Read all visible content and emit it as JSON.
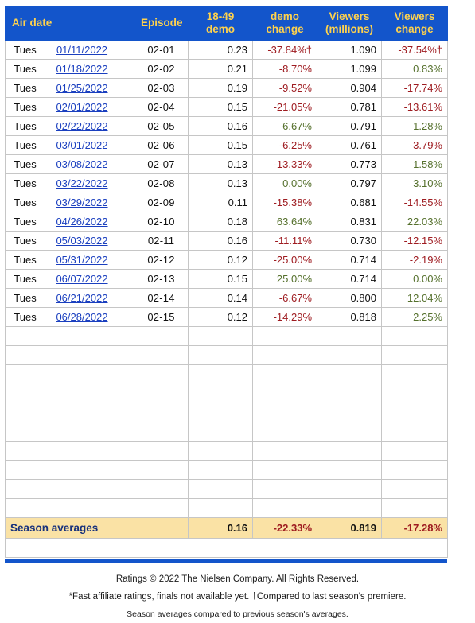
{
  "table": {
    "headers": {
      "air_date": "Air date",
      "episode": "Episode",
      "demo_line1": "18-49",
      "demo_line2": "demo",
      "demo_change_line1": "demo",
      "demo_change_line2": "change",
      "viewers_line1": "Viewers",
      "viewers_line2": "(millions)",
      "viewers_change_line1": "Viewers",
      "viewers_change_line2": "change"
    },
    "rows": [
      {
        "day": "Tues",
        "date": "01/11/2022",
        "note": "",
        "episode": "02-01",
        "demo": "0.23",
        "demo_change": "-37.84%†",
        "demo_change_sign": "neg",
        "viewers": "1.090",
        "viewers_change": "-37.54%†",
        "viewers_change_sign": "neg"
      },
      {
        "day": "Tues",
        "date": "01/18/2022",
        "note": "",
        "episode": "02-02",
        "demo": "0.21",
        "demo_change": "-8.70%",
        "demo_change_sign": "neg",
        "viewers": "1.099",
        "viewers_change": "0.83%",
        "viewers_change_sign": "pos"
      },
      {
        "day": "Tues",
        "date": "01/25/2022",
        "note": "",
        "episode": "02-03",
        "demo": "0.19",
        "demo_change": "-9.52%",
        "demo_change_sign": "neg",
        "viewers": "0.904",
        "viewers_change": "-17.74%",
        "viewers_change_sign": "neg"
      },
      {
        "day": "Tues",
        "date": "02/01/2022",
        "note": "",
        "episode": "02-04",
        "demo": "0.15",
        "demo_change": "-21.05%",
        "demo_change_sign": "neg",
        "viewers": "0.781",
        "viewers_change": "-13.61%",
        "viewers_change_sign": "neg"
      },
      {
        "day": "Tues",
        "date": "02/22/2022",
        "note": "",
        "episode": "02-05",
        "demo": "0.16",
        "demo_change": "6.67%",
        "demo_change_sign": "pos",
        "viewers": "0.791",
        "viewers_change": "1.28%",
        "viewers_change_sign": "pos"
      },
      {
        "day": "Tues",
        "date": "03/01/2022",
        "note": "",
        "episode": "02-06",
        "demo": "0.15",
        "demo_change": "-6.25%",
        "demo_change_sign": "neg",
        "viewers": "0.761",
        "viewers_change": "-3.79%",
        "viewers_change_sign": "neg"
      },
      {
        "day": "Tues",
        "date": "03/08/2022",
        "note": "",
        "episode": "02-07",
        "demo": "0.13",
        "demo_change": "-13.33%",
        "demo_change_sign": "neg",
        "viewers": "0.773",
        "viewers_change": "1.58%",
        "viewers_change_sign": "pos"
      },
      {
        "day": "Tues",
        "date": "03/22/2022",
        "note": "",
        "episode": "02-08",
        "demo": "0.13",
        "demo_change": "0.00%",
        "demo_change_sign": "pos",
        "viewers": "0.797",
        "viewers_change": "3.10%",
        "viewers_change_sign": "pos"
      },
      {
        "day": "Tues",
        "date": "03/29/2022",
        "note": "",
        "episode": "02-09",
        "demo": "0.11",
        "demo_change": "-15.38%",
        "demo_change_sign": "neg",
        "viewers": "0.681",
        "viewers_change": "-14.55%",
        "viewers_change_sign": "neg"
      },
      {
        "day": "Tues",
        "date": "04/26/2022",
        "note": "",
        "episode": "02-10",
        "demo": "0.18",
        "demo_change": "63.64%",
        "demo_change_sign": "pos",
        "viewers": "0.831",
        "viewers_change": "22.03%",
        "viewers_change_sign": "pos"
      },
      {
        "day": "Tues",
        "date": "05/03/2022",
        "note": "",
        "episode": "02-11",
        "demo": "0.16",
        "demo_change": "-11.11%",
        "demo_change_sign": "neg",
        "viewers": "0.730",
        "viewers_change": "-12.15%",
        "viewers_change_sign": "neg"
      },
      {
        "day": "Tues",
        "date": "05/31/2022",
        "note": "",
        "episode": "02-12",
        "demo": "0.12",
        "demo_change": "-25.00%",
        "demo_change_sign": "neg",
        "viewers": "0.714",
        "viewers_change": "-2.19%",
        "viewers_change_sign": "neg"
      },
      {
        "day": "Tues",
        "date": "06/07/2022",
        "note": "",
        "episode": "02-13",
        "demo": "0.15",
        "demo_change": "25.00%",
        "demo_change_sign": "pos",
        "viewers": "0.714",
        "viewers_change": "0.00%",
        "viewers_change_sign": "pos"
      },
      {
        "day": "Tues",
        "date": "06/21/2022",
        "note": "",
        "episode": "02-14",
        "demo": "0.14",
        "demo_change": "-6.67%",
        "demo_change_sign": "neg",
        "viewers": "0.800",
        "viewers_change": "12.04%",
        "viewers_change_sign": "pos"
      },
      {
        "day": "Tues",
        "date": "06/28/2022",
        "note": "",
        "episode": "02-15",
        "demo": "0.12",
        "demo_change": "-14.29%",
        "demo_change_sign": "neg",
        "viewers": "0.818",
        "viewers_change": "2.25%",
        "viewers_change_sign": "pos"
      }
    ],
    "empty_row_count": 10,
    "averages": {
      "label": "Season averages",
      "demo": "0.16",
      "demo_change": "-22.33%",
      "demo_change_sign": "neg",
      "viewers": "0.819",
      "viewers_change": "-17.28%",
      "viewers_change_sign": "neg"
    }
  },
  "footnotes": {
    "copyright": "Ratings © 2022 The Nielsen Company. All Rights Reserved.",
    "asterisk_note": "*Fast affiliate ratings, finals not available yet. †Compared to last season's premiere.",
    "averages_note": "Season averages compared to previous season's averages."
  },
  "colors": {
    "header_blue": "#1355cb",
    "header_text_gold": "#ffd24d",
    "link_blue": "#1a3fbf",
    "negative_red": "#9e1b20",
    "positive_green": "#55702c",
    "averages_bg": "#fae2a5",
    "averages_label": "#17317c",
    "grid_line": "#c6c6c6"
  }
}
